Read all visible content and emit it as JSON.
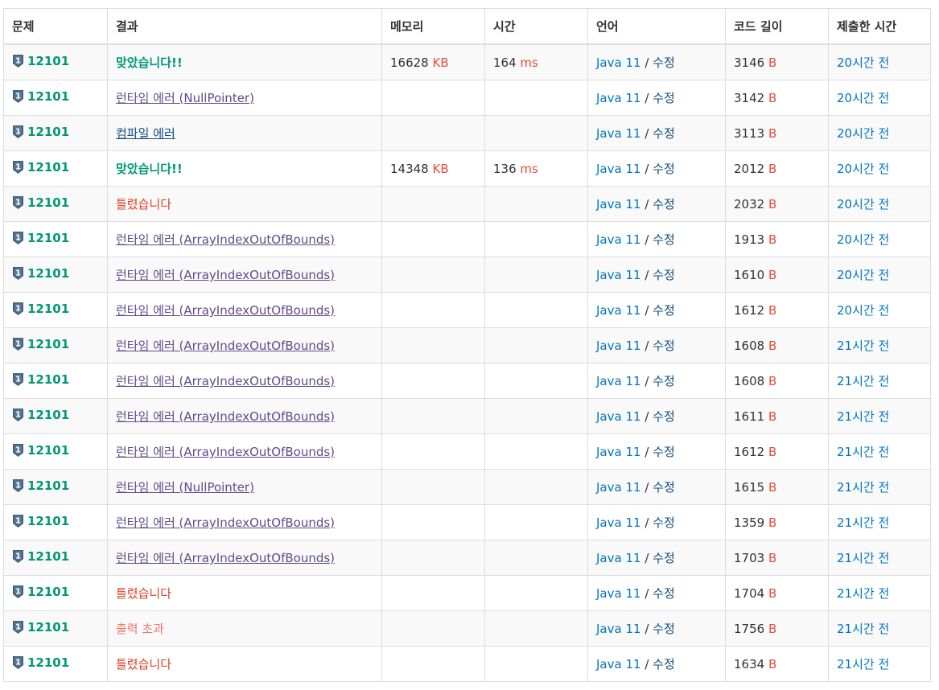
{
  "headers": [
    "문제",
    "결과",
    "메모리",
    "시간",
    "언어",
    "코드 길이",
    "제출한 시간"
  ],
  "units": {
    "memory": "KB",
    "time": "ms",
    "code": "B"
  },
  "language_sep": "/",
  "rows": [
    {
      "problem": "12101",
      "result": "맞았습니다!!",
      "result_type": "ac",
      "memory": "16628",
      "time": "164",
      "language": "Java 11",
      "edit": "수정",
      "code_length": "3146",
      "submitted": "20시간 전"
    },
    {
      "problem": "12101",
      "result": "런타임 에러 (NullPointer)",
      "result_type": "rte",
      "memory": "",
      "time": "",
      "language": "Java 11",
      "edit": "수정",
      "code_length": "3142",
      "submitted": "20시간 전"
    },
    {
      "problem": "12101",
      "result": "컴파일 에러",
      "result_type": "ce",
      "memory": "",
      "time": "",
      "language": "Java 11",
      "edit": "수정",
      "code_length": "3113",
      "submitted": "20시간 전"
    },
    {
      "problem": "12101",
      "result": "맞았습니다!!",
      "result_type": "ac",
      "memory": "14348",
      "time": "136",
      "language": "Java 11",
      "edit": "수정",
      "code_length": "2012",
      "submitted": "20시간 전"
    },
    {
      "problem": "12101",
      "result": "틀렸습니다",
      "result_type": "wa",
      "memory": "",
      "time": "",
      "language": "Java 11",
      "edit": "수정",
      "code_length": "2032",
      "submitted": "20시간 전"
    },
    {
      "problem": "12101",
      "result": "런타임 에러 (ArrayIndexOutOfBounds)",
      "result_type": "rte",
      "memory": "",
      "time": "",
      "language": "Java 11",
      "edit": "수정",
      "code_length": "1913",
      "submitted": "20시간 전"
    },
    {
      "problem": "12101",
      "result": "런타임 에러 (ArrayIndexOutOfBounds)",
      "result_type": "rte",
      "memory": "",
      "time": "",
      "language": "Java 11",
      "edit": "수정",
      "code_length": "1610",
      "submitted": "20시간 전"
    },
    {
      "problem": "12101",
      "result": "런타임 에러 (ArrayIndexOutOfBounds)",
      "result_type": "rte",
      "memory": "",
      "time": "",
      "language": "Java 11",
      "edit": "수정",
      "code_length": "1612",
      "submitted": "20시간 전"
    },
    {
      "problem": "12101",
      "result": "런타임 에러 (ArrayIndexOutOfBounds)",
      "result_type": "rte",
      "memory": "",
      "time": "",
      "language": "Java 11",
      "edit": "수정",
      "code_length": "1608",
      "submitted": "21시간 전"
    },
    {
      "problem": "12101",
      "result": "런타임 에러 (ArrayIndexOutOfBounds)",
      "result_type": "rte",
      "memory": "",
      "time": "",
      "language": "Java 11",
      "edit": "수정",
      "code_length": "1608",
      "submitted": "21시간 전"
    },
    {
      "problem": "12101",
      "result": "런타임 에러 (ArrayIndexOutOfBounds)",
      "result_type": "rte",
      "memory": "",
      "time": "",
      "language": "Java 11",
      "edit": "수정",
      "code_length": "1611",
      "submitted": "21시간 전"
    },
    {
      "problem": "12101",
      "result": "런타임 에러 (ArrayIndexOutOfBounds)",
      "result_type": "rte",
      "memory": "",
      "time": "",
      "language": "Java 11",
      "edit": "수정",
      "code_length": "1612",
      "submitted": "21시간 전"
    },
    {
      "problem": "12101",
      "result": "런타임 에러 (NullPointer)",
      "result_type": "rte",
      "memory": "",
      "time": "",
      "language": "Java 11",
      "edit": "수정",
      "code_length": "1615",
      "submitted": "21시간 전"
    },
    {
      "problem": "12101",
      "result": "런타임 에러 (ArrayIndexOutOfBounds)",
      "result_type": "rte",
      "memory": "",
      "time": "",
      "language": "Java 11",
      "edit": "수정",
      "code_length": "1359",
      "submitted": "21시간 전"
    },
    {
      "problem": "12101",
      "result": "런타임 에러 (ArrayIndexOutOfBounds)",
      "result_type": "rte",
      "memory": "",
      "time": "",
      "language": "Java 11",
      "edit": "수정",
      "code_length": "1703",
      "submitted": "21시간 전"
    },
    {
      "problem": "12101",
      "result": "틀렸습니다",
      "result_type": "wa",
      "memory": "",
      "time": "",
      "language": "Java 11",
      "edit": "수정",
      "code_length": "1704",
      "submitted": "21시간 전"
    },
    {
      "problem": "12101",
      "result": "출력 초과",
      "result_type": "ol",
      "memory": "",
      "time": "",
      "language": "Java 11",
      "edit": "수정",
      "code_length": "1756",
      "submitted": "21시간 전"
    },
    {
      "problem": "12101",
      "result": "틀렸습니다",
      "result_type": "wa",
      "memory": "",
      "time": "",
      "language": "Java 11",
      "edit": "수정",
      "code_length": "1634",
      "submitted": "21시간 전"
    }
  ],
  "tier_icon": {
    "name": "silver-1-tier-icon",
    "color": "#435f7a",
    "text": "1"
  },
  "colors": {
    "accepted": "#009874",
    "wrong": "#dd4124",
    "runtime_error": "#5f4b8b",
    "compile_error": "#0f4c81",
    "output_limit": "#fa7268",
    "unit": "#e74c3c",
    "link": "#0076c0"
  }
}
